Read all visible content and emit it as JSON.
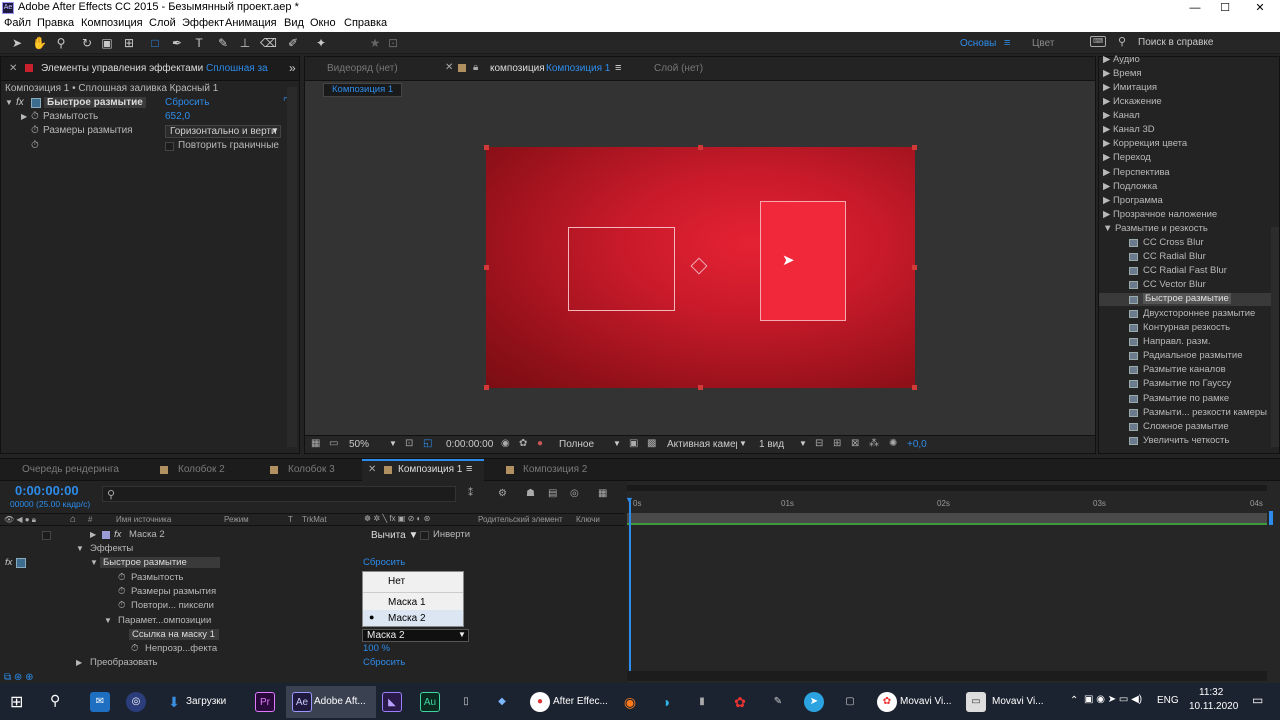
{
  "window": {
    "title": "Adobe After Effects CC 2015 - Безымянный проект.aep *",
    "app_badge": "Ae"
  },
  "menu": [
    "Файл",
    "Правка",
    "Композиция",
    "Слой",
    "Эффект",
    "Анимация",
    "Вид",
    "Окно",
    "Справка"
  ],
  "workspace": {
    "basic": "Основы",
    "color": "Цвет",
    "search_placeholder": "Поиск в справке"
  },
  "fx_panel": {
    "tab_label": "Элементы управления эффектами",
    "tab_layer": "Сплошная зал",
    "breadcrumb": "Композиция 1 • Сплошная заливка Красный 1",
    "effect_name": "Быстрое размытие",
    "reset": "Сбросить",
    "blurriness_label": "Размытость",
    "blurriness_value": "652,0",
    "dimensions_label": "Размеры размытия",
    "dimensions_value": "Горизонтально и верти",
    "repeat_label": "Повторить граничные"
  },
  "comp_panel": {
    "tab_footage": "Видеоряд (нет)",
    "tab_comp_prefix": "композиция",
    "tab_comp_name": "Композиция 1",
    "tab_layer": "Слой (нет)",
    "flow_tab": "Композиция 1",
    "zoom": "50%",
    "timecode": "0:00:00:00",
    "resolution": "Полное",
    "camera": "Активная камер",
    "views": "1 вид",
    "exposure": "+0,0"
  },
  "effects_list": {
    "categories": [
      "Аудио",
      "Время",
      "Имитация",
      "Искажение",
      "Канал",
      "Канал 3D",
      "Коррекция цвета",
      "Переход",
      "Перспектива",
      "Подложка",
      "Программа",
      "Прозрачное наложение",
      "Размытие и резкость"
    ],
    "blur_items": [
      "CC Cross Blur",
      "CC Radial Blur",
      "CC Radial Fast Blur",
      "CC Vector Blur",
      "Быстрое размытие",
      "Двухстороннее размытие",
      "Контурная резкость",
      "Направл. разм.",
      "Радиальное размытие",
      "Размытие каналов",
      "Размытие по Гауссу",
      "Размытие по рамке",
      "Размыти... резкости камеры",
      "Сложное размытие",
      "Увеличить четкость"
    ],
    "selected": "Быстрое размытие"
  },
  "timeline": {
    "tabs": [
      "Очередь рендеринга",
      "Колобок 2",
      "Колобок 3",
      "Композиция 1",
      "Композиция 2"
    ],
    "active_tab": "Композиция 1",
    "timecode": "0:00:00:00",
    "frame_info": "00000 (25.00 кадр/с)",
    "columns": {
      "source": "Имя источника",
      "mode": "Режим",
      "t": "T",
      "trkmat": "TrkMat",
      "parent": "Родительский элемент",
      "keys": "Ключи"
    },
    "ruler": [
      "0s",
      "01s",
      "02s",
      "03s",
      "04s"
    ],
    "rows": {
      "mask2": "Маска 2",
      "mask_mode": "Вычита",
      "invert": "Инверти",
      "effects": "Эффекты",
      "fast_blur": "Быстрое размытие",
      "reset": "Сбросить",
      "blurriness": "Размытость",
      "dimensions": "Размеры размытия",
      "repeat": "Повтори... пиксели",
      "comp_params": "Парамет...омпозиции",
      "mask_ref": "Ссылка на маску 1",
      "mask_ref_value": "Маска 2",
      "opacity": "Непрозр...фекта",
      "opacity_value": "100 %",
      "transform": "Преобразовать",
      "transform_reset": "Сбросить"
    },
    "popup_options": [
      "Нет",
      "Маска 1",
      "Маска 2"
    ],
    "popup_selected": "Маска 2"
  },
  "taskbar": {
    "downloads": "Загрузки",
    "ae": "Adobe Aft...",
    "chrome": "After Effec...",
    "movavi1": "Movavi Vi...",
    "movavi2": "Movavi Vi...",
    "lang": "ENG",
    "time": "11:32",
    "date": "10.11.2020"
  },
  "colors": {
    "accent": "#2d8ceb",
    "comp_red": "#c81a2a",
    "rect_red": "#f0283a"
  }
}
